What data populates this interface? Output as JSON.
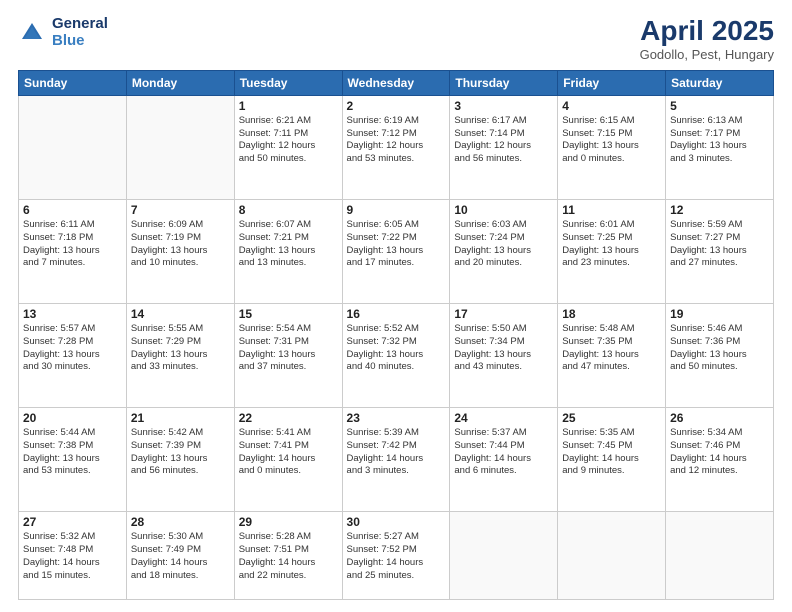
{
  "header": {
    "logo_general": "General",
    "logo_blue": "Blue",
    "month_title": "April 2025",
    "location": "Godollo, Pest, Hungary"
  },
  "weekdays": [
    "Sunday",
    "Monday",
    "Tuesday",
    "Wednesday",
    "Thursday",
    "Friday",
    "Saturday"
  ],
  "weeks": [
    [
      {
        "day": "",
        "info": ""
      },
      {
        "day": "",
        "info": ""
      },
      {
        "day": "1",
        "info": "Sunrise: 6:21 AM\nSunset: 7:11 PM\nDaylight: 12 hours\nand 50 minutes."
      },
      {
        "day": "2",
        "info": "Sunrise: 6:19 AM\nSunset: 7:12 PM\nDaylight: 12 hours\nand 53 minutes."
      },
      {
        "day": "3",
        "info": "Sunrise: 6:17 AM\nSunset: 7:14 PM\nDaylight: 12 hours\nand 56 minutes."
      },
      {
        "day": "4",
        "info": "Sunrise: 6:15 AM\nSunset: 7:15 PM\nDaylight: 13 hours\nand 0 minutes."
      },
      {
        "day": "5",
        "info": "Sunrise: 6:13 AM\nSunset: 7:17 PM\nDaylight: 13 hours\nand 3 minutes."
      }
    ],
    [
      {
        "day": "6",
        "info": "Sunrise: 6:11 AM\nSunset: 7:18 PM\nDaylight: 13 hours\nand 7 minutes."
      },
      {
        "day": "7",
        "info": "Sunrise: 6:09 AM\nSunset: 7:19 PM\nDaylight: 13 hours\nand 10 minutes."
      },
      {
        "day": "8",
        "info": "Sunrise: 6:07 AM\nSunset: 7:21 PM\nDaylight: 13 hours\nand 13 minutes."
      },
      {
        "day": "9",
        "info": "Sunrise: 6:05 AM\nSunset: 7:22 PM\nDaylight: 13 hours\nand 17 minutes."
      },
      {
        "day": "10",
        "info": "Sunrise: 6:03 AM\nSunset: 7:24 PM\nDaylight: 13 hours\nand 20 minutes."
      },
      {
        "day": "11",
        "info": "Sunrise: 6:01 AM\nSunset: 7:25 PM\nDaylight: 13 hours\nand 23 minutes."
      },
      {
        "day": "12",
        "info": "Sunrise: 5:59 AM\nSunset: 7:27 PM\nDaylight: 13 hours\nand 27 minutes."
      }
    ],
    [
      {
        "day": "13",
        "info": "Sunrise: 5:57 AM\nSunset: 7:28 PM\nDaylight: 13 hours\nand 30 minutes."
      },
      {
        "day": "14",
        "info": "Sunrise: 5:55 AM\nSunset: 7:29 PM\nDaylight: 13 hours\nand 33 minutes."
      },
      {
        "day": "15",
        "info": "Sunrise: 5:54 AM\nSunset: 7:31 PM\nDaylight: 13 hours\nand 37 minutes."
      },
      {
        "day": "16",
        "info": "Sunrise: 5:52 AM\nSunset: 7:32 PM\nDaylight: 13 hours\nand 40 minutes."
      },
      {
        "day": "17",
        "info": "Sunrise: 5:50 AM\nSunset: 7:34 PM\nDaylight: 13 hours\nand 43 minutes."
      },
      {
        "day": "18",
        "info": "Sunrise: 5:48 AM\nSunset: 7:35 PM\nDaylight: 13 hours\nand 47 minutes."
      },
      {
        "day": "19",
        "info": "Sunrise: 5:46 AM\nSunset: 7:36 PM\nDaylight: 13 hours\nand 50 minutes."
      }
    ],
    [
      {
        "day": "20",
        "info": "Sunrise: 5:44 AM\nSunset: 7:38 PM\nDaylight: 13 hours\nand 53 minutes."
      },
      {
        "day": "21",
        "info": "Sunrise: 5:42 AM\nSunset: 7:39 PM\nDaylight: 13 hours\nand 56 minutes."
      },
      {
        "day": "22",
        "info": "Sunrise: 5:41 AM\nSunset: 7:41 PM\nDaylight: 14 hours\nand 0 minutes."
      },
      {
        "day": "23",
        "info": "Sunrise: 5:39 AM\nSunset: 7:42 PM\nDaylight: 14 hours\nand 3 minutes."
      },
      {
        "day": "24",
        "info": "Sunrise: 5:37 AM\nSunset: 7:44 PM\nDaylight: 14 hours\nand 6 minutes."
      },
      {
        "day": "25",
        "info": "Sunrise: 5:35 AM\nSunset: 7:45 PM\nDaylight: 14 hours\nand 9 minutes."
      },
      {
        "day": "26",
        "info": "Sunrise: 5:34 AM\nSunset: 7:46 PM\nDaylight: 14 hours\nand 12 minutes."
      }
    ],
    [
      {
        "day": "27",
        "info": "Sunrise: 5:32 AM\nSunset: 7:48 PM\nDaylight: 14 hours\nand 15 minutes."
      },
      {
        "day": "28",
        "info": "Sunrise: 5:30 AM\nSunset: 7:49 PM\nDaylight: 14 hours\nand 18 minutes."
      },
      {
        "day": "29",
        "info": "Sunrise: 5:28 AM\nSunset: 7:51 PM\nDaylight: 14 hours\nand 22 minutes."
      },
      {
        "day": "30",
        "info": "Sunrise: 5:27 AM\nSunset: 7:52 PM\nDaylight: 14 hours\nand 25 minutes."
      },
      {
        "day": "",
        "info": ""
      },
      {
        "day": "",
        "info": ""
      },
      {
        "day": "",
        "info": ""
      }
    ]
  ]
}
